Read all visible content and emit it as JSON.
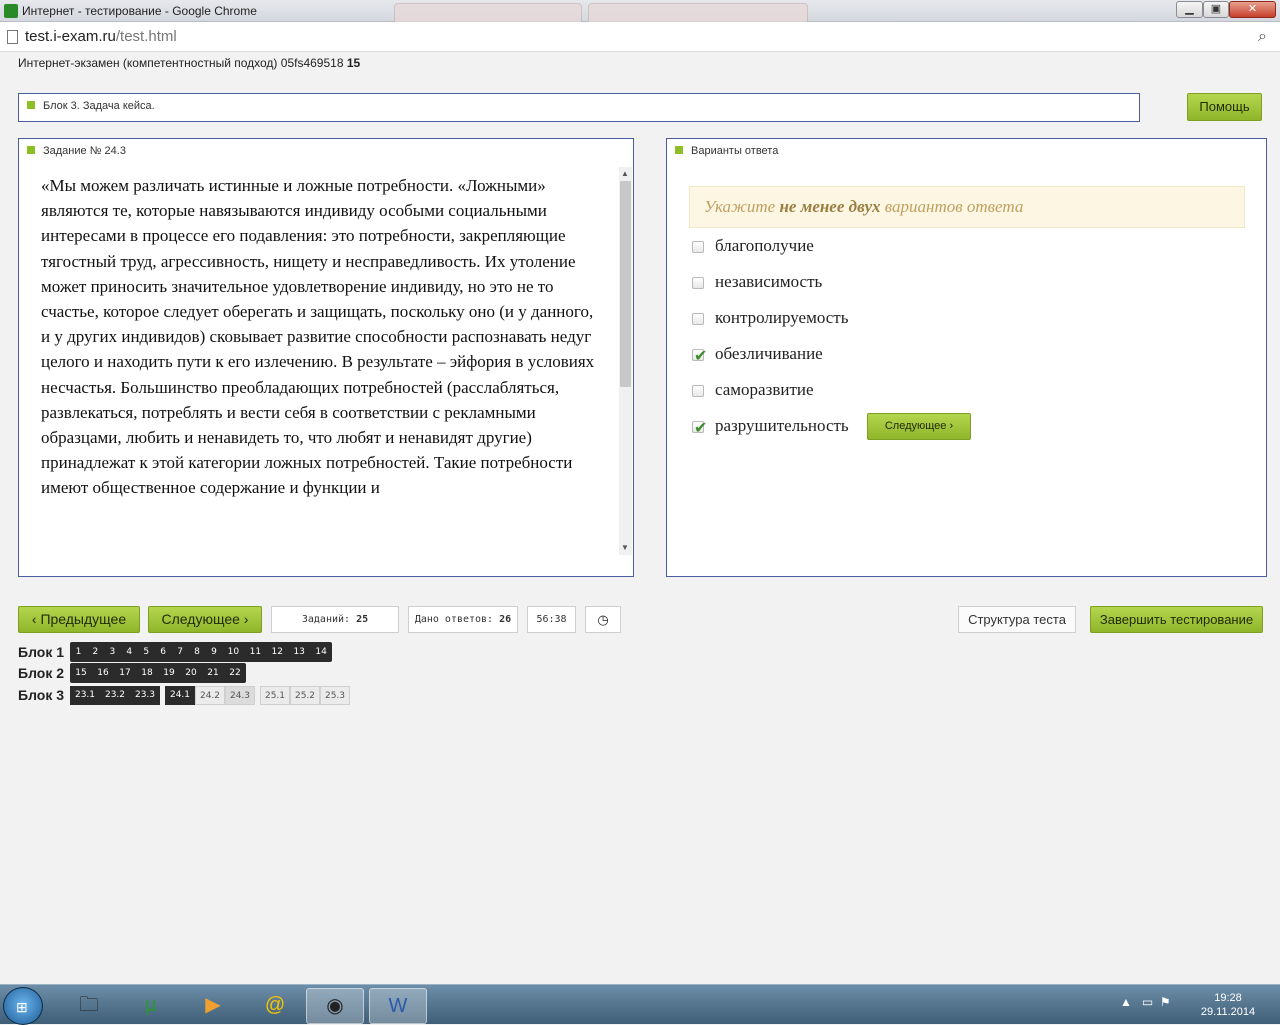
{
  "window": {
    "title": "Интернет - тестирование - Google Chrome"
  },
  "address": {
    "host": "test.i-exam.ru",
    "path": "/test.html"
  },
  "exam": {
    "header_prefix": "Интернет-экзамен (компетентностный подход) 05fs469518 ",
    "header_num": "15"
  },
  "block_panel": {
    "title": "Блок 3. Задача кейса."
  },
  "help_label": "Помощь",
  "task": {
    "title": "Задание № 24.3",
    "text": "«Мы можем различать истинные и ложные потребности. «Ложными» являются те, которые навязываются индивиду особыми социальными интересами в процессе его подавления: это потребности, закрепляющие тягостный труд, агрессивность, нищету и несправедливость. Их утоление может приносить значительное удовлетворение индивиду, но это не то счастье, которое следует оберегать и защищать, поскольку оно (и у данного, и у других индивидов) сковывает развитие способности распознавать недуг целого и находить пути к его излечению. В результате – эйфория в условиях несчастья. Большинство преобладающих потребностей (расслабляться, развлекаться, потреблять и вести себя в соответствии с рекламными образцами, любить и ненавидеть то, что любят и ненавидят другие) принадлежат к этой категории ложных потребностей. Такие потребности имеют общественное содержание и функции и"
  },
  "answers": {
    "title": "Варианты ответа",
    "hint_pre": "Укажите ",
    "hint_bold": "не менее двух",
    "hint_post": " вариантов ответа",
    "options": [
      {
        "label": "благополучие",
        "checked": false
      },
      {
        "label": "независимость",
        "checked": false
      },
      {
        "label": "контролируемость",
        "checked": false
      },
      {
        "label": "обезличивание",
        "checked": true
      },
      {
        "label": "саморазвитие",
        "checked": false
      },
      {
        "label": "разрушительность",
        "checked": true
      }
    ],
    "next_label": "Следующее"
  },
  "nav": {
    "prev_label": "Предыдущее",
    "next_label": "Следующее",
    "tasks_label": "Заданий:",
    "tasks_value": "25",
    "answers_label": "Дано ответов:",
    "answers_value": "26",
    "timer": "56:38",
    "structure_label": "Структура теста",
    "finish_label": "Завершить тестирование"
  },
  "blocks": [
    {
      "label": "Блок 1",
      "items": [
        "1",
        "2",
        "3",
        "4",
        "5",
        "6",
        "7",
        "8",
        "9",
        "10",
        "11",
        "12",
        "13",
        "14"
      ]
    },
    {
      "label": "Блок 2",
      "items": [
        "15",
        "16",
        "17",
        "18",
        "19",
        "20",
        "21",
        "22"
      ]
    },
    {
      "label": "Блок 3",
      "items": [
        "23.1",
        "23.2",
        "23.3",
        "24.1",
        "24.2",
        "24.3",
        "25.1",
        "25.2",
        "25.3"
      ]
    }
  ],
  "taskbar": {
    "time": "19:28",
    "date": "29.11.2014"
  },
  "colors": {
    "accent_green": "#8fb52a",
    "panel_border": "#4a5ea0",
    "hint_bg": "#fcf6e3"
  }
}
